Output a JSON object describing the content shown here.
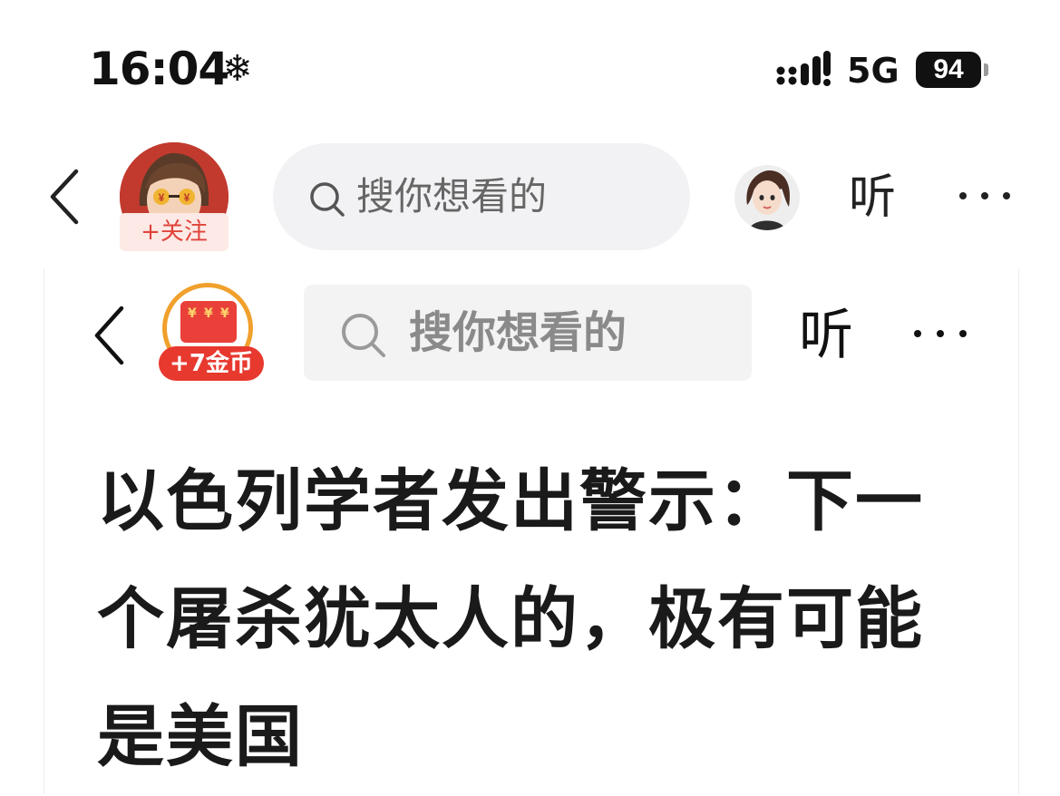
{
  "status_bar": {
    "time": "16:04",
    "status_icon": "snowflake-icon",
    "network": "5G",
    "battery": "94"
  },
  "top_nav": {
    "back_icon": "chevron-left-icon",
    "follow_label": "+关注",
    "search_placeholder": "搜你想看的",
    "listen_label": "听",
    "more_icon": "more-horizontal-icon"
  },
  "embedded_page": {
    "coin_badge": "+7金币",
    "coin_bag_symbols": [
      "¥",
      "¥",
      "¥"
    ],
    "search_placeholder": "搜你想看的",
    "listen_label": "听",
    "headline": "以色列学者发出警示：下一个屠杀犹太人的，极有可能是美国"
  },
  "colors": {
    "accent_red": "#e8392f",
    "follow_text": "#e0443a",
    "coin_ring": "#f0a02c",
    "search_bg": "#f2f2f4"
  }
}
